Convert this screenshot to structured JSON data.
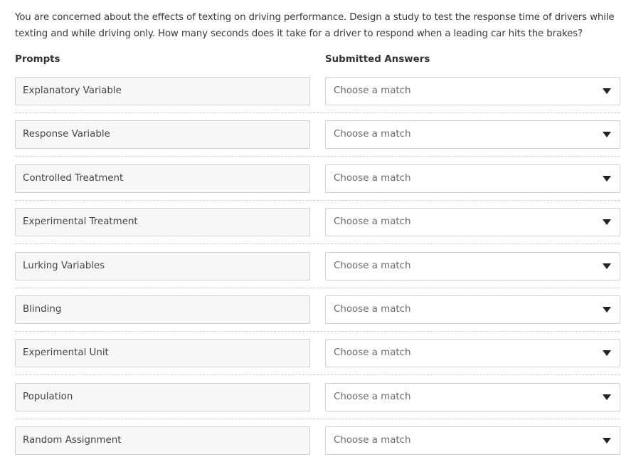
{
  "question": "You are concerned about the effects of texting on driving performance. Design a study to test the response time of drivers while texting and while driving only. How many seconds does it take for a driver to respond when a leading car hits the brakes?",
  "headers": {
    "prompts": "Prompts",
    "answers": "Submitted Answers"
  },
  "rows": [
    {
      "prompt": "Explanatory Variable",
      "answer_placeholder": "Choose a match"
    },
    {
      "prompt": "Response Variable",
      "answer_placeholder": "Choose a match"
    },
    {
      "prompt": "Controlled Treatment",
      "answer_placeholder": "Choose a match"
    },
    {
      "prompt": "Experimental Treatment",
      "answer_placeholder": "Choose a match"
    },
    {
      "prompt": "Lurking Variables",
      "answer_placeholder": "Choose a match"
    },
    {
      "prompt": "Blinding",
      "answer_placeholder": "Choose a match"
    },
    {
      "prompt": "Experimental Unit",
      "answer_placeholder": "Choose a match"
    },
    {
      "prompt": "Population",
      "answer_placeholder": "Choose a match"
    },
    {
      "prompt": "Random Assignment",
      "answer_placeholder": "Choose a match"
    }
  ],
  "icons": {
    "dropdown": "caret-down-icon"
  }
}
